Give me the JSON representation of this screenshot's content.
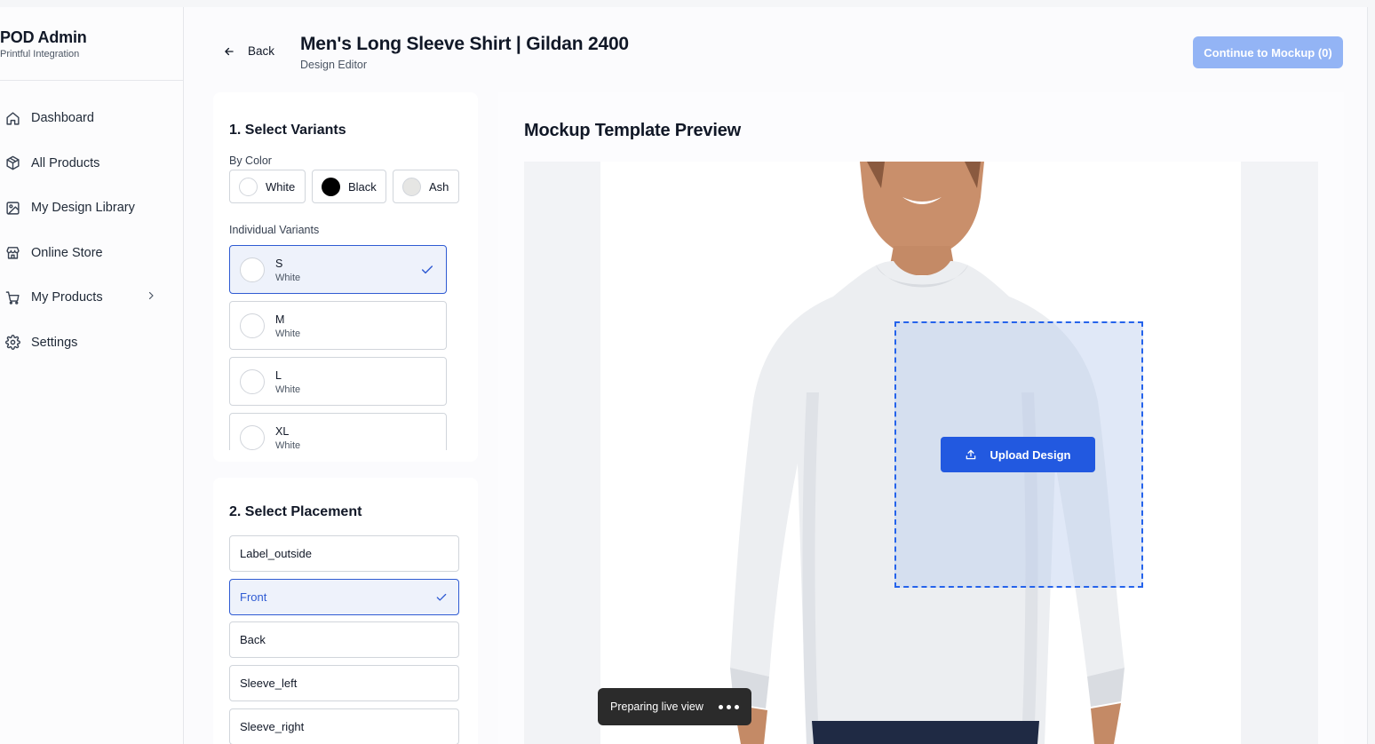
{
  "brand": {
    "title": "POD Admin",
    "subtitle": "Printful Integration"
  },
  "nav": [
    {
      "label": "Dashboard",
      "icon": "home-icon"
    },
    {
      "label": "All Products",
      "icon": "package-icon"
    },
    {
      "label": "My Design Library",
      "icon": "image-icon"
    },
    {
      "label": "Online Store",
      "icon": "store-icon"
    },
    {
      "label": "My Products",
      "icon": "cart-icon"
    },
    {
      "label": "Settings",
      "icon": "gear-icon"
    }
  ],
  "header": {
    "back_label": "Back",
    "title": "Men's Long Sleeve Shirt | Gildan 2400",
    "subtitle": "Design Editor",
    "continue_label": "Continue to Mockup (0)"
  },
  "variants": {
    "section_title": "1. Select Variants",
    "by_color_label": "By Color",
    "colors": [
      {
        "label": "White",
        "hex": "#ffffff"
      },
      {
        "label": "Black",
        "hex": "#000000"
      },
      {
        "label": "Ash",
        "hex": "#e6e6e4"
      }
    ],
    "individual_label": "Individual Variants",
    "items": [
      {
        "size": "S",
        "color": "White",
        "selected": true
      },
      {
        "size": "M",
        "color": "White",
        "selected": false
      },
      {
        "size": "L",
        "color": "White",
        "selected": false
      },
      {
        "size": "XL",
        "color": "White",
        "selected": false
      }
    ]
  },
  "placement": {
    "section_title": "2. Select Placement",
    "items": [
      {
        "label": "Label_outside",
        "selected": false
      },
      {
        "label": "Front",
        "selected": true
      },
      {
        "label": "Back",
        "selected": false
      },
      {
        "label": "Sleeve_left",
        "selected": false
      },
      {
        "label": "Sleeve_right",
        "selected": false
      }
    ]
  },
  "preview": {
    "title": "Mockup Template Preview",
    "upload_label": "Upload Design"
  },
  "toast": {
    "label": "Preparing live view"
  },
  "colors": {
    "accent": "#2259e0",
    "accent_disabled": "#93b4f5",
    "selected_border": "#2f5bd3"
  }
}
